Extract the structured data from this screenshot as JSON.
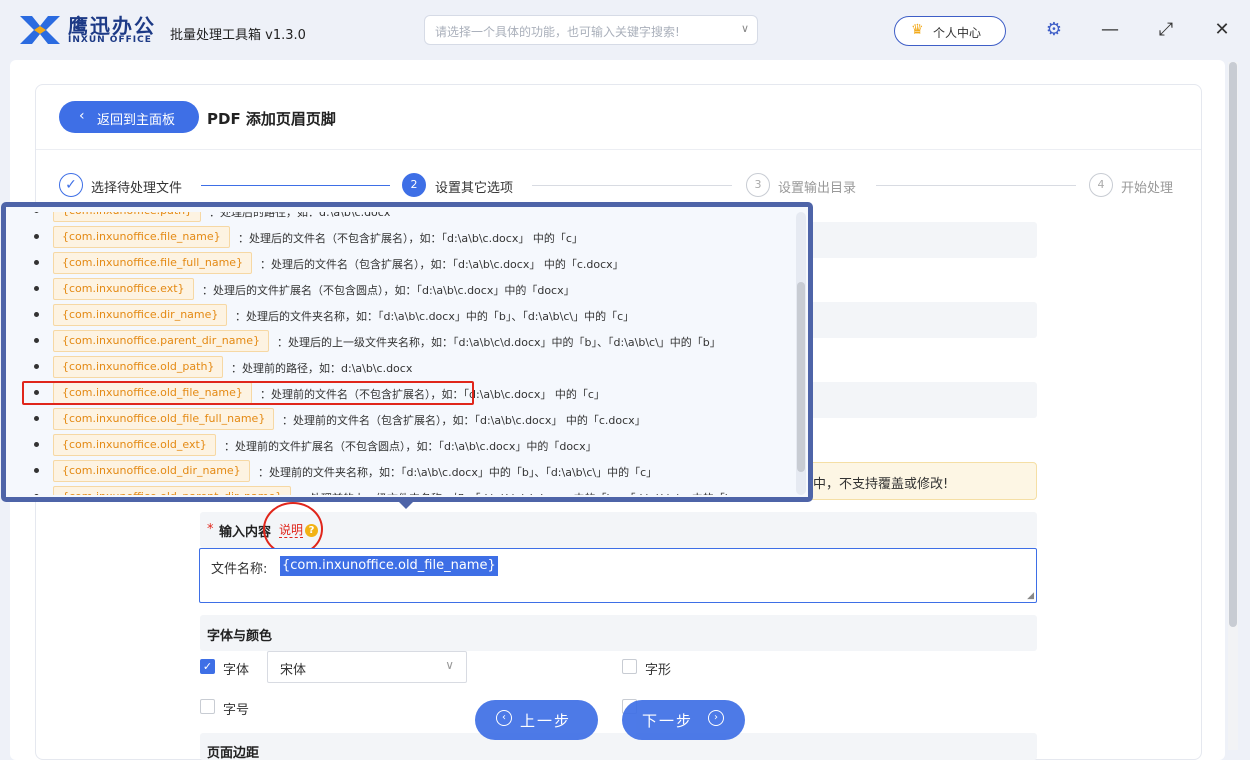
{
  "app": {
    "brand_cn": "鹰迅办公",
    "brand_en": "INXUN OFFICE",
    "title": "批量处理工具箱 v1.3.0",
    "search_placeholder": "请选择一个具体的功能，也可输入关键字搜索!",
    "user_center": "个人中心"
  },
  "header": {
    "back_label": "返回到主面板",
    "page_title": "PDF 添加页眉页脚"
  },
  "steps": [
    {
      "num": "✓",
      "label": "选择待处理文件",
      "state": "done"
    },
    {
      "num": "2",
      "label": "设置其它选项",
      "state": "active"
    },
    {
      "num": "3",
      "label": "设置输出目录",
      "state": "pending"
    },
    {
      "num": "4",
      "label": "开始处理",
      "state": "pending"
    }
  ],
  "popover": {
    "items": [
      {
        "tag": "{com.inxunoffice.path}",
        "desc": "：处理后的路径，如：d:\\a\\b\\c.docx"
      },
      {
        "tag": "{com.inxunoffice.file_name}",
        "desc": "：处理后的文件名（不包含扩展名），如：「d:\\a\\b\\c.docx」 中的「c」"
      },
      {
        "tag": "{com.inxunoffice.file_full_name}",
        "desc": "：处理后的文件名（包含扩展名），如：「d:\\a\\b\\c.docx」 中的「c.docx」"
      },
      {
        "tag": "{com.inxunoffice.ext}",
        "desc": "：处理后的文件扩展名（不包含圆点），如：「d:\\a\\b\\c.docx」中的「docx」"
      },
      {
        "tag": "{com.inxunoffice.dir_name}",
        "desc": "：处理后的文件夹名称，如：「d:\\a\\b\\c.docx」中的「b」、「d:\\a\\b\\c\\」中的「c」"
      },
      {
        "tag": "{com.inxunoffice.parent_dir_name}",
        "desc": "：处理后的上一级文件夹名称，如：「d:\\a\\b\\c\\d.docx」中的「b」、「d:\\a\\b\\c\\」中的「b」"
      },
      {
        "tag": "{com.inxunoffice.old_path}",
        "desc": "：处理前的路径，如：d:\\a\\b\\c.docx"
      },
      {
        "tag": "{com.inxunoffice.old_file_name}",
        "desc": "：处理前的文件名（不包含扩展名），如：「d:\\a\\b\\c.docx」 中的「c」"
      },
      {
        "tag": "{com.inxunoffice.old_file_full_name}",
        "desc": "：处理前的文件名（包含扩展名），如：「d:\\a\\b\\c.docx」 中的「c.docx」"
      },
      {
        "tag": "{com.inxunoffice.old_ext}",
        "desc": "：处理前的文件扩展名（不包含圆点），如：「d:\\a\\b\\c.docx」中的「docx」"
      },
      {
        "tag": "{com.inxunoffice.old_dir_name}",
        "desc": "：处理前的文件夹名称，如：「d:\\a\\b\\c.docx」中的「b」、「d:\\a\\b\\c\\」中的「c」"
      },
      {
        "tag": "{com.inxunoffice.old_parent_dir_name}",
        "desc": "：处理前的上一级文件夹名称，如：「d:\\a\\b\\c\\d.docx」中的「b」、「d:\\a\\b\\c\\」中的「b」"
      }
    ]
  },
  "notice": "中，不支持覆盖或修改!",
  "input": {
    "label": "输入内容",
    "explain": "说明",
    "prefix": "文件名称:",
    "selected": "{com.inxunoffice.old_file_name}"
  },
  "font_section": {
    "title": "字体与颜色",
    "font_label": "字体",
    "font_value": "宋体",
    "style_label": "字形",
    "size_label": "字号"
  },
  "margin_section": {
    "title": "页面边距"
  },
  "nav": {
    "prev": "上一步",
    "next": "下一步"
  },
  "colors": {
    "accent": "#3e6fe6",
    "highlight": "#e0261b",
    "popover_border": "#4e64a8"
  }
}
